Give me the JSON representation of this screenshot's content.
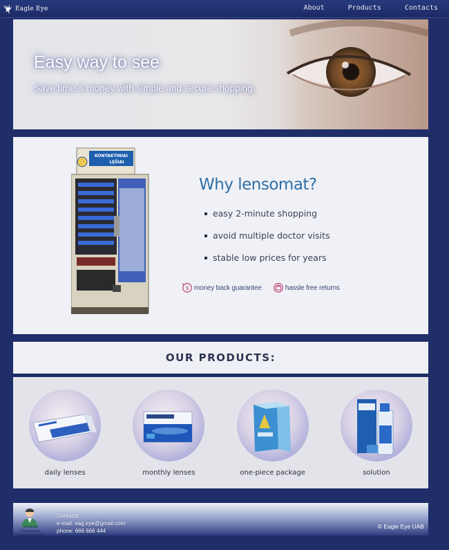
{
  "brand": {
    "name": "Eagle Eye"
  },
  "nav": {
    "items": [
      {
        "label": "About"
      },
      {
        "label": "Products"
      },
      {
        "label": "Contacts"
      }
    ]
  },
  "hero": {
    "title": "Easy way to see",
    "subtitle": "Save time & money with simple and secure shopping."
  },
  "vending": {
    "sign_line1": "KONTAKTINIAI",
    "sign_line2": "LĘŠIAI"
  },
  "why": {
    "title": "Why lensomat?",
    "bullets": [
      "easy 2-minute shopping",
      "avoid multiple doctor visits",
      "stable low prices for years"
    ],
    "badges": [
      {
        "label": "money back guarantee",
        "icon": "dollar-icon"
      },
      {
        "label": "hassle free returns",
        "icon": "return-icon"
      }
    ]
  },
  "products": {
    "title": "OUR  PRODUCTS:",
    "items": [
      {
        "label": "daily lenses"
      },
      {
        "label": "monthly lenses"
      },
      {
        "label": "one-piece package"
      },
      {
        "label": "solution"
      }
    ]
  },
  "footer": {
    "ceo_name": "Vardenis Pavardenis",
    "ceo_role": "CEO & founder",
    "contacts_title": "Contacts:",
    "email": "e-mail: eag.eye@gmail.com",
    "phone": "phone: 666 666 444",
    "copyright": "© Eagle Eye UAB"
  },
  "colors": {
    "background": "#1f2d68",
    "accent": "#2f6fa6",
    "panel": "#f0f1f6"
  }
}
